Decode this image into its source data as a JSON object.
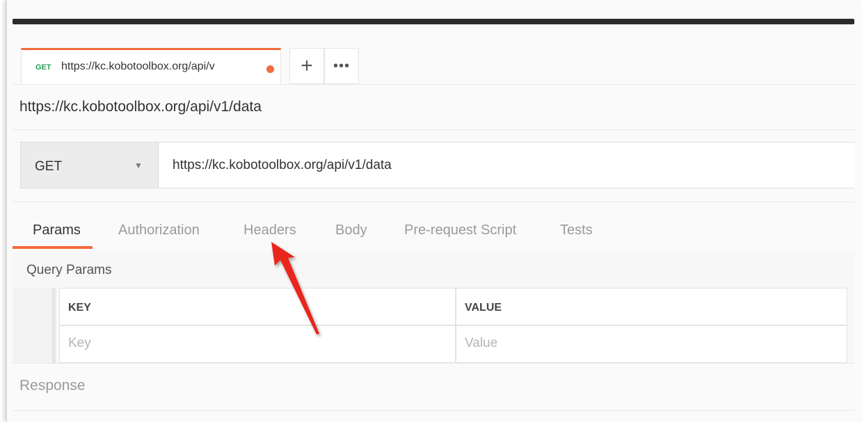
{
  "tab": {
    "method": "GET",
    "url": "https://kc.kobotoolbox.org/api/v",
    "accent_color": "#f26b3a",
    "method_color": "#26a35a"
  },
  "tab_actions": {
    "add_icon": "plus-icon",
    "more_icon": "more-icon"
  },
  "request": {
    "title": "https://kc.kobotoolbox.org/api/v1/data",
    "method": "GET",
    "url": "https://kc.kobotoolbox.org/api/v1/data"
  },
  "tabs": [
    {
      "label": "Params",
      "active": true
    },
    {
      "label": "Authorization",
      "active": false
    },
    {
      "label": "Headers",
      "active": false
    },
    {
      "label": "Body",
      "active": false
    },
    {
      "label": "Pre-request Script",
      "active": false
    },
    {
      "label": "Tests",
      "active": false
    }
  ],
  "query_params": {
    "title": "Query Params",
    "columns": [
      "KEY",
      "VALUE"
    ],
    "key_placeholder": "Key",
    "value_placeholder": "Value"
  },
  "response": {
    "label": "Response"
  },
  "annotation": {
    "color": "#e8261f",
    "icon": "red-arrow-annotation"
  }
}
